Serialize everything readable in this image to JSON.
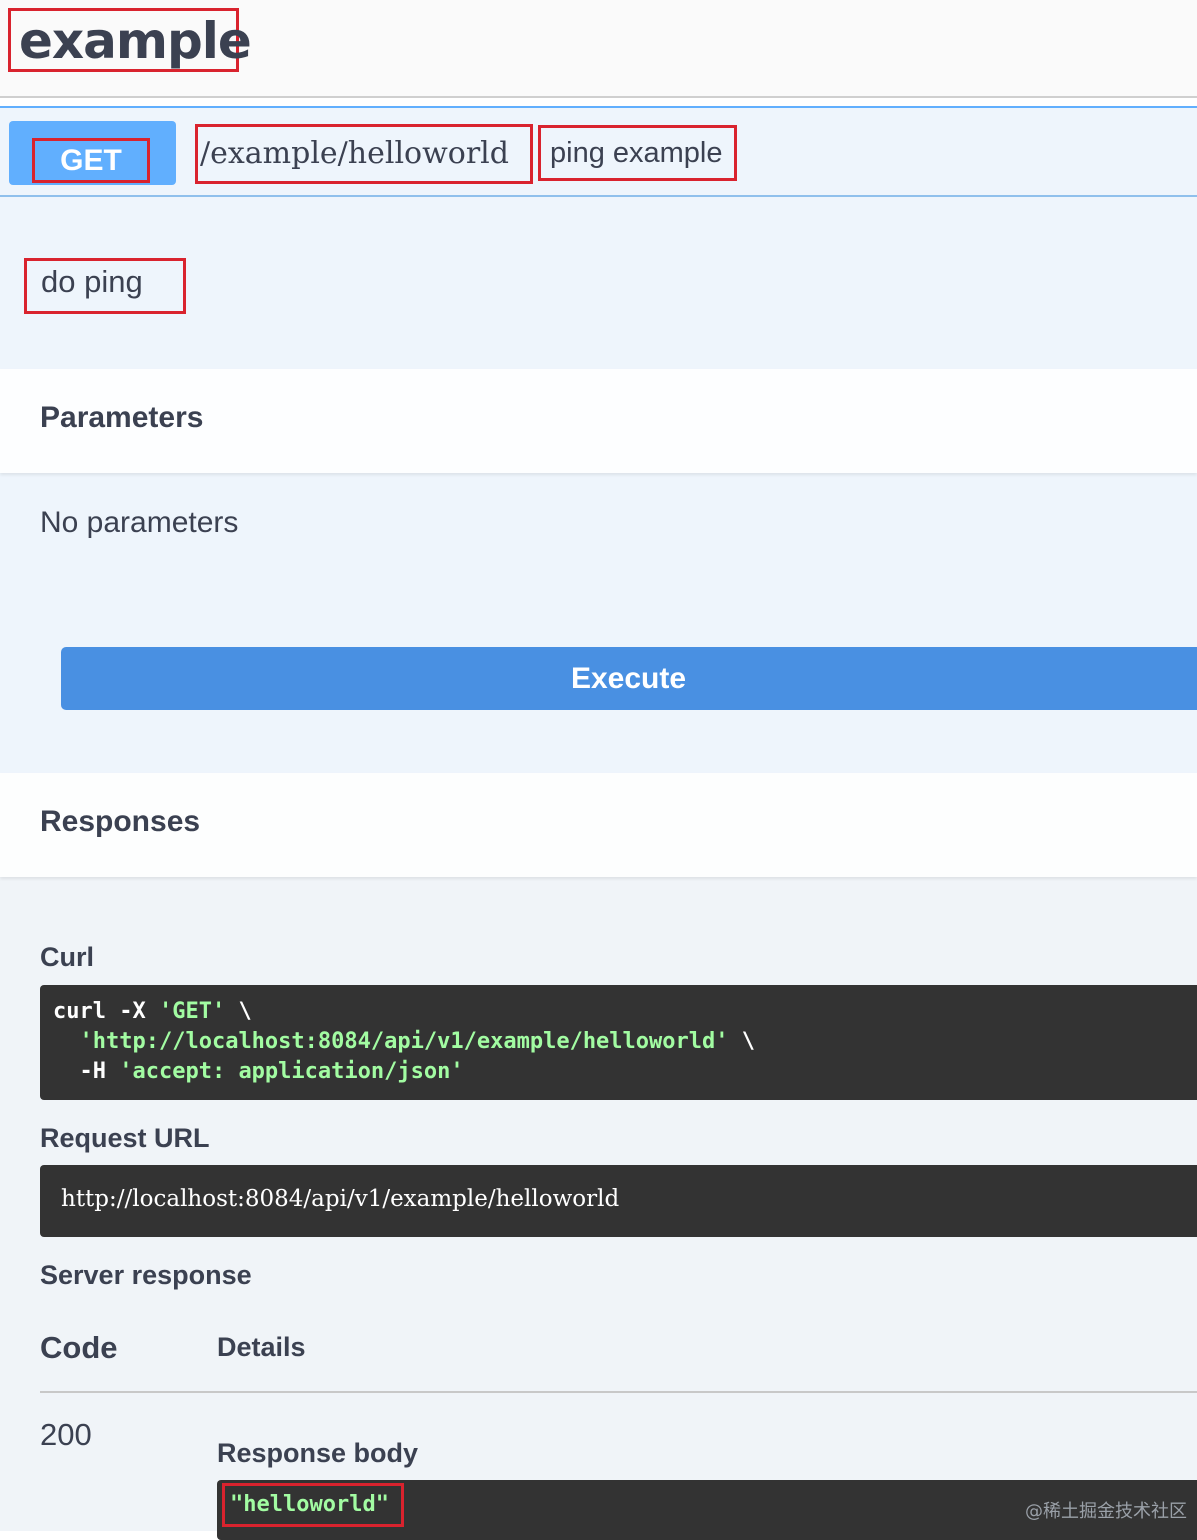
{
  "tag": {
    "title": "example"
  },
  "operation": {
    "method": "GET",
    "path": "/example/helloworld",
    "summary": "ping example",
    "description": "do ping"
  },
  "parameters": {
    "title": "Parameters",
    "empty_text": "No parameters"
  },
  "execute_label": "Execute",
  "responses": {
    "title": "Responses",
    "curl_label": "Curl",
    "curl": {
      "line1_cmd": "curl -X ",
      "line1_method": "'GET'",
      "line1_end": " \\",
      "line2_indent": "  ",
      "line2_url": "'http://localhost:8084/api/v1/example/helloworld'",
      "line2_end": " \\",
      "line3_flag": "  -H ",
      "line3_header": "'accept: application/json'"
    },
    "request_url_label": "Request URL",
    "request_url": "http://localhost:8084/api/v1/example/helloworld",
    "server_response_label": "Server response",
    "col_code": "Code",
    "col_details": "Details",
    "code": "200",
    "response_body_label": "Response body",
    "response_body": "\"helloworld\""
  },
  "watermark": "@稀土掘金技术社区",
  "colors": {
    "get_method": "#61affe",
    "execute": "#4990e2",
    "code_bg": "#333333",
    "code_string": "#a2fca2",
    "highlight": "#d9232e"
  }
}
